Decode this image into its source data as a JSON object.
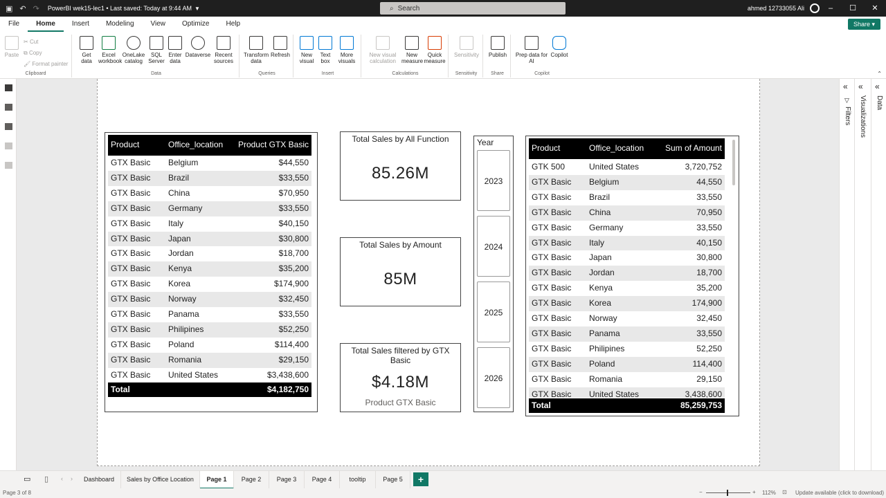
{
  "titlebar": {
    "doc_title": "PowerBI wek15-lec1 • Last saved: Today at 9:44 AM",
    "search_placeholder": "Search",
    "user_name": "ahmed 12733055 Ali",
    "controls": [
      "–",
      "☐",
      "✕"
    ]
  },
  "menu": {
    "tabs": [
      "File",
      "Home",
      "Insert",
      "Modeling",
      "View",
      "Optimize",
      "Help"
    ],
    "active": "Home",
    "share_label": "Share"
  },
  "ribbon": {
    "clipboard": {
      "paste": "Paste",
      "cut": "Cut",
      "copy": "Copy",
      "format_painter": "Format painter",
      "group": "Clipboard"
    },
    "data": {
      "buttons": [
        "Get data",
        "Excel workbook",
        "OneLake catalog",
        "SQL Server",
        "Enter data",
        "Dataverse",
        "Recent sources"
      ],
      "group": "Data"
    },
    "queries": {
      "buttons": [
        "Transform data",
        "Refresh"
      ],
      "group": "Queries"
    },
    "insert": {
      "buttons": [
        "New visual",
        "Text box",
        "More visuals"
      ],
      "group": "Insert"
    },
    "calculations": {
      "buttons": [
        "New visual calculation",
        "New measure",
        "Quick measure"
      ],
      "group": "Calculations"
    },
    "sensitivity": {
      "buttons": [
        "Sensitivity"
      ],
      "group": "Sensitivity"
    },
    "share": {
      "buttons": [
        "Publish"
      ],
      "group": "Share"
    },
    "copilot": {
      "buttons": [
        "Prep data for AI",
        "Copilot"
      ],
      "group": "Copilot"
    }
  },
  "left_table": {
    "headers": [
      "Product",
      "Office_location",
      "Product GTX Basic"
    ],
    "rows": [
      [
        "GTX Basic",
        "Belgium",
        "$44,550"
      ],
      [
        "GTX Basic",
        "Brazil",
        "$33,550"
      ],
      [
        "GTX Basic",
        "China",
        "$70,950"
      ],
      [
        "GTX Basic",
        "Germany",
        "$33,550"
      ],
      [
        "GTX Basic",
        "Italy",
        "$40,150"
      ],
      [
        "GTX Basic",
        "Japan",
        "$30,800"
      ],
      [
        "GTX Basic",
        "Jordan",
        "$18,700"
      ],
      [
        "GTX Basic",
        "Kenya",
        "$35,200"
      ],
      [
        "GTX Basic",
        "Korea",
        "$174,900"
      ],
      [
        "GTX Basic",
        "Norway",
        "$32,450"
      ],
      [
        "GTX Basic",
        "Panama",
        "$33,550"
      ],
      [
        "GTX Basic",
        "Philipines",
        "$52,250"
      ],
      [
        "GTX Basic",
        "Poland",
        "$114,400"
      ],
      [
        "GTX Basic",
        "Romania",
        "$29,150"
      ],
      [
        "GTX Basic",
        "United States",
        "$3,438,600"
      ]
    ],
    "total_label": "Total",
    "total_value": "$4,182,750"
  },
  "cards": [
    {
      "title": "Total Sales by All Function",
      "value": "85.26M",
      "subtitle": ""
    },
    {
      "title": "Total Sales by Amount",
      "value": "85M",
      "subtitle": ""
    },
    {
      "title": "Total Sales filtered by GTX Basic",
      "value": "$4.18M",
      "subtitle": "Product GTX Basic"
    }
  ],
  "slicer": {
    "title": "Year",
    "options": [
      "2023",
      "2024",
      "2025",
      "2026"
    ]
  },
  "right_table": {
    "headers": [
      "Product",
      "Office_location",
      "Sum of Amount"
    ],
    "rows": [
      [
        "GTK 500",
        "United States",
        "3,720,752"
      ],
      [
        "GTX Basic",
        "Belgium",
        "44,550"
      ],
      [
        "GTX Basic",
        "Brazil",
        "33,550"
      ],
      [
        "GTX Basic",
        "China",
        "70,950"
      ],
      [
        "GTX Basic",
        "Germany",
        "33,550"
      ],
      [
        "GTX Basic",
        "Italy",
        "40,150"
      ],
      [
        "GTX Basic",
        "Japan",
        "30,800"
      ],
      [
        "GTX Basic",
        "Jordan",
        "18,700"
      ],
      [
        "GTX Basic",
        "Kenya",
        "35,200"
      ],
      [
        "GTX Basic",
        "Korea",
        "174,900"
      ],
      [
        "GTX Basic",
        "Norway",
        "32,450"
      ],
      [
        "GTX Basic",
        "Panama",
        "33,550"
      ],
      [
        "GTX Basic",
        "Philipines",
        "52,250"
      ],
      [
        "GTX Basic",
        "Poland",
        "114,400"
      ],
      [
        "GTX Basic",
        "Romania",
        "29,150"
      ],
      [
        "GTX Basic",
        "United States",
        "3,438,600"
      ]
    ],
    "total_label": "Total",
    "total_value": "85,259,753"
  },
  "panes": {
    "filters": "Filters",
    "visualizations": "Visualizations",
    "data": "Data"
  },
  "page_tabs": [
    "Dashboard",
    "Sales by Office Location",
    "Page 1",
    "Page 2",
    "Page 3",
    "Page 4",
    "tooltip",
    "Page 5"
  ],
  "active_page": "Page 1",
  "add_page": "+",
  "status": {
    "page_info": "Page 3 of 8",
    "zoom": "112%",
    "update": "Update available (click to download)"
  }
}
